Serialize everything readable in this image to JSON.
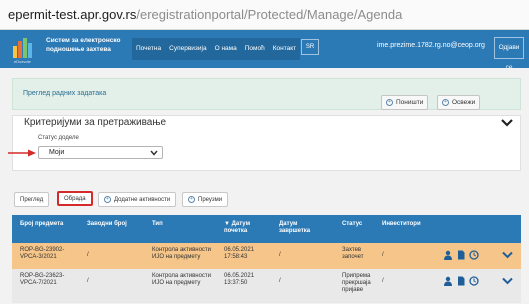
{
  "browser": {
    "url_host": "epermit-test.apr.gov.rs",
    "url_path": "/eregistrationportal/Protected/Manage/Agenda"
  },
  "header": {
    "logo_word": "eDozvole",
    "logo_text_line1": "Систем за електронско",
    "logo_text_line2": "подношење захтева",
    "nav": [
      "Почетна",
      "Супервизија",
      "О нама",
      "Помоћ",
      "Контакт"
    ],
    "lang": "SR",
    "user_email": "ime.prezime.1782.rg.no@ceop.org",
    "logout": "Одјави се"
  },
  "overview": {
    "title": "Преглед радних задатака"
  },
  "criteria": {
    "title": "Критеријуми за претраживање",
    "status_label": "Статус доделе",
    "status_value": "Моји",
    "cancel": "Поништи",
    "refresh": "Освежи"
  },
  "tabs": [
    {
      "label": "Преглед"
    },
    {
      "label": "Обрада"
    },
    {
      "label": "Додатне активности"
    },
    {
      "label": "Преузми"
    }
  ],
  "table": {
    "headers": [
      "Број предмета",
      "Заводни број",
      "Тип",
      "▼ Датум почетка",
      "Датум завршетка",
      "Статус",
      "Инвеститори"
    ],
    "rows": [
      {
        "number": "ROP-BG-23902-VPCA-3/2021",
        "reg": "/",
        "type": "Контрола активности ИЈО на предмету",
        "start": "06.05.2021 17:58:43",
        "end": "/",
        "status": "Захтев започет",
        "investors": "/"
      },
      {
        "number": "ROP-BG-23623-VPCA-7/2021",
        "reg": "/",
        "type": "Контрола активности ИЈО на предмету",
        "start": "06.05.2021 13:37:50",
        "end": "/",
        "status": "Припрема прекршаја пријаве",
        "investors": "/"
      }
    ]
  },
  "colors": {
    "header_blue": "#2b79b5",
    "row_highlight": "#f5c58a",
    "annotation_red": "#d42a2a"
  }
}
